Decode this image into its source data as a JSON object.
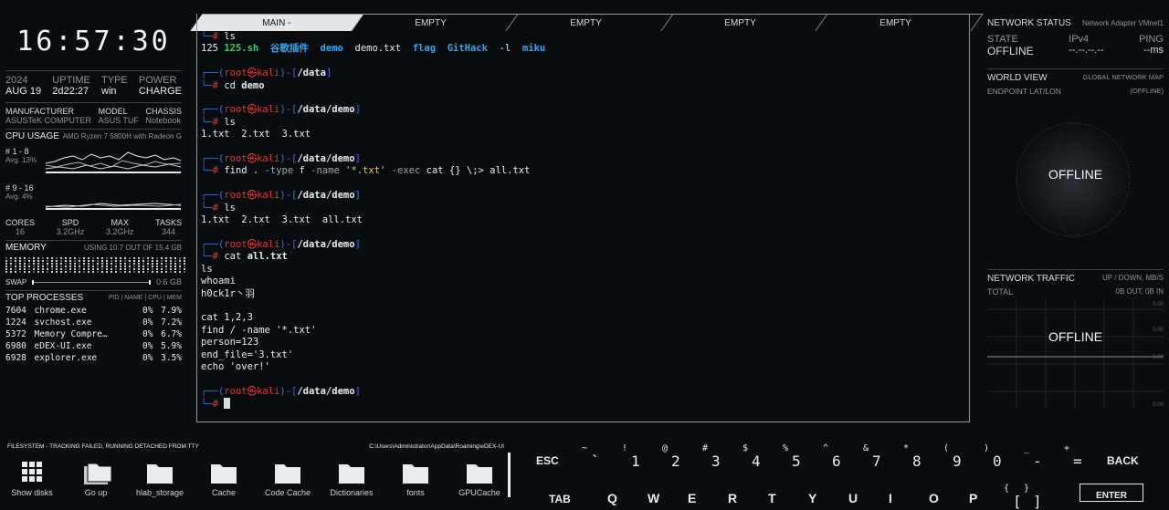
{
  "clock": "16:57:30",
  "system": {
    "year": "2024",
    "date": "AUG 19",
    "uptime_label": "UPTIME",
    "uptime": "2d22:27",
    "type_label": "TYPE",
    "type": "win",
    "power_label": "POWER",
    "power": "CHARGE"
  },
  "hardware": {
    "manufacturer_label": "MANUFACTURER",
    "manufacturer": "ASUSTeK COMPUTER",
    "model_label": "MODEL",
    "model": "ASUS TUF",
    "chassis_label": "CHASSIS",
    "chassis": "Notebook"
  },
  "cpu": {
    "title": "CPU USAGE",
    "name": "AMD Ryzen 7 5800H with Radeon G",
    "group1_label": "# 1 - 8",
    "group1_avg": "Avg. 13%",
    "group2_label": "# 9 - 16",
    "group2_avg": "Avg. 4%",
    "cores_label": "CORES",
    "cores": "16",
    "spd_label": "SPD",
    "spd": "3.2GHz",
    "max_label": "MAX",
    "max": "3.2GHz",
    "tasks_label": "TASKS",
    "tasks": "344"
  },
  "memory": {
    "title": "MEMORY",
    "usage": "USING 10.7 OUT OF 15.4 GB",
    "swap_label": "SWAP",
    "swap_value": "0.6 GB"
  },
  "processes": {
    "title": "TOP PROCESSES",
    "header": "PID | NAME | CPU | MEM",
    "rows": [
      {
        "pid": "7604",
        "name": "chrome.exe",
        "cpu": "0%",
        "mem": "7.9%"
      },
      {
        "pid": "1224",
        "name": "svchost.exe",
        "cpu": "0%",
        "mem": "7.2%"
      },
      {
        "pid": "5372",
        "name": "Memory Compre…",
        "cpu": "0%",
        "mem": "6.7%"
      },
      {
        "pid": "6980",
        "name": "eDEX-UI.exe",
        "cpu": "0%",
        "mem": "5.9%"
      },
      {
        "pid": "6928",
        "name": "explorer.exe",
        "cpu": "0%",
        "mem": "3.5%"
      }
    ]
  },
  "tabs": [
    "MAIN -",
    "EMPTY",
    "EMPTY",
    "EMPTY",
    "EMPTY"
  ],
  "terminal": {
    "ls_cmd": "ls",
    "ls_out_prefix": "125 ",
    "ls_out_items": [
      "125.sh",
      "谷歌插件",
      "demo",
      "demo.txt",
      "flag",
      "GitHack",
      "-l",
      "miku"
    ],
    "prompt_user": "root",
    "prompt_at": "㉿",
    "prompt_host": "kali",
    "path_data": "/data",
    "path_demo": "/data/demo",
    "cmd_cd": "cd demo",
    "cmd_ls": "ls",
    "out_ls1": "1.txt  2.txt  3.txt",
    "cmd_find": "find . -type f -name '*.txt' -exec cat {} \\;> all.txt",
    "out_ls2": "1.txt  2.txt  3.txt  all.txt",
    "cmd_cat": "cat all.txt",
    "cat_out": [
      "ls",
      "whoami",
      "h0ck1r丶羽",
      "",
      "cat 1,2,3",
      "find / -name '*.txt'",
      "person=123",
      "end_file='3.txt'",
      "echo 'over!'"
    ]
  },
  "network": {
    "status_title": "NETWORK STATUS",
    "adapter": "Network Adapter VMnet1",
    "state_label": "STATE",
    "state": "OFFLINE",
    "ipv4_label": "IPv4",
    "ipv4": "--.--.--.--",
    "ping_label": "PING",
    "ping": "--ms",
    "world_title": "WORLD VIEW",
    "world_sub": "GLOBAL NETWORK MAP",
    "endpoint_label": "ENDPOINT LAT/LON",
    "endpoint_value": "(OFFLINE)",
    "globe_offline": "OFFLINE",
    "traffic_title": "NETWORK TRAFFIC",
    "traffic_sub": "UP / DOWN, MB/S",
    "total_label": "TOTAL",
    "total_value": "0B OUT, 0B IN",
    "traffic_offline": "OFFLINE",
    "axis_values": [
      "0.00",
      "0.00",
      "0.00",
      "0.00"
    ]
  },
  "filesystem": {
    "status": "FILESYSTEM - TRACKING FAILED, RUNNING DETACHED FROM TTY",
    "path": "C:\\Users\\Administrator\\AppData\\Roaming\\eDEX-UI",
    "items": [
      "Show disks",
      "Go up",
      "hlab_storage",
      "Cache",
      "Code Cache",
      "Dictionaries",
      "fonts",
      "GPUCache"
    ]
  },
  "keyboard": {
    "esc": "ESC",
    "back": "BACK",
    "enter": "ENTER",
    "tab": "TAB",
    "row1": [
      {
        "top": "~",
        "main": "`"
      },
      {
        "top": "!",
        "main": "1"
      },
      {
        "top": "@",
        "main": "2"
      },
      {
        "top": "#",
        "main": "3"
      },
      {
        "top": "$",
        "main": "4"
      },
      {
        "top": "%",
        "main": "5"
      },
      {
        "top": "^",
        "main": "6"
      },
      {
        "top": "&",
        "main": "7"
      },
      {
        "top": "*",
        "main": "8"
      },
      {
        "top": "(",
        "main": "9"
      },
      {
        "top": ")",
        "main": "0"
      },
      {
        "top": "_",
        "main": "-"
      },
      {
        "top": "+",
        "main": "="
      }
    ],
    "row2": [
      "Q",
      "W",
      "E",
      "R",
      "T",
      "Y",
      "U",
      "I",
      "O",
      "P"
    ],
    "row2_brackets": [
      {
        "top": "{",
        "main": "["
      },
      {
        "top": "}",
        "main": "]"
      }
    ]
  }
}
